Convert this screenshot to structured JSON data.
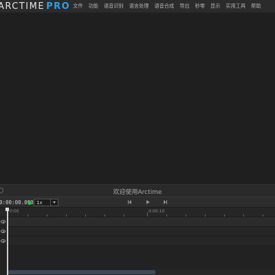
{
  "app": {
    "brand_main": "ARCTIME",
    "brand_pro": "PRO",
    "accent_color": "#2f9ee8"
  },
  "menu": {
    "items": [
      {
        "label": "文件"
      },
      {
        "label": "功能"
      },
      {
        "label": "语音识别"
      },
      {
        "label": "语言处理"
      },
      {
        "label": "语音合成"
      },
      {
        "label": "导出"
      },
      {
        "label": "秒零"
      },
      {
        "label": "显示"
      },
      {
        "label": "实用工具"
      },
      {
        "label": "帮助"
      }
    ]
  },
  "panel": {
    "title": "欢迎使用Arctime"
  },
  "transport": {
    "timecode": "0:00:00.000",
    "status_color": "#3bb54a",
    "speed": "1x",
    "icons": [
      "skip-back-icon",
      "play-icon",
      "skip-forward-icon"
    ]
  },
  "timeline": {
    "ruler_labels": [
      "0:00",
      "0:00:10"
    ],
    "track_icons": [
      "eye-icon",
      "eye-icon",
      "eye-icon"
    ]
  }
}
